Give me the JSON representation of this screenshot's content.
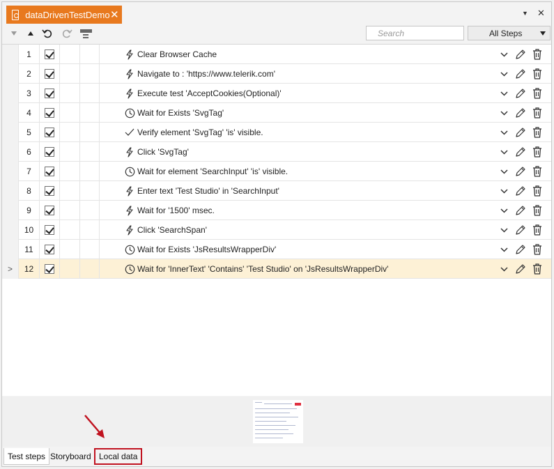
{
  "tab": {
    "title": "dataDrivenTestDemo",
    "close": "✕"
  },
  "window_controls": {
    "menu": "▼",
    "close": "✕"
  },
  "toolbar": {
    "search_placeholder": "Search",
    "filter_value": "All Steps"
  },
  "steps": [
    {
      "num": "1",
      "icon": "lightning-icon",
      "text": "Clear Browser Cache"
    },
    {
      "num": "2",
      "icon": "lightning-icon",
      "text": "Navigate to : 'https://www.telerik.com'"
    },
    {
      "num": "3",
      "icon": "lightning-icon",
      "text": "Execute test 'AcceptCookies(Optional)'"
    },
    {
      "num": "4",
      "icon": "clock-icon",
      "text": "Wait for Exists 'SvgTag'"
    },
    {
      "num": "5",
      "icon": "checkmark-icon",
      "text": "Verify element 'SvgTag' 'is' visible."
    },
    {
      "num": "6",
      "icon": "lightning-icon",
      "text": "Click 'SvgTag'"
    },
    {
      "num": "7",
      "icon": "clock-icon",
      "text": "Wait for element 'SearchInput' 'is' visible."
    },
    {
      "num": "8",
      "icon": "lightning-icon",
      "text": "Enter text 'Test Studio' in 'SearchInput'"
    },
    {
      "num": "9",
      "icon": "lightning-icon",
      "text": "Wait for '1500' msec."
    },
    {
      "num": "10",
      "icon": "lightning-icon",
      "text": "Click 'SearchSpan'"
    },
    {
      "num": "11",
      "icon": "clock-icon",
      "text": "Wait for Exists 'JsResultsWrapperDiv'"
    },
    {
      "num": "12",
      "icon": "clock-icon",
      "text": "Wait for 'InnerText' 'Contains' 'Test Studio' on 'JsResultsWrapperDiv'",
      "selected": true,
      "expander": ">"
    }
  ],
  "bottom_tabs": {
    "test_steps": "Test steps",
    "storyboard": "Storyboard",
    "local_data": "Local data"
  },
  "colors": {
    "accent": "#e8791e",
    "selected_row": "#fdf1d6",
    "highlight": "#c0121f"
  }
}
